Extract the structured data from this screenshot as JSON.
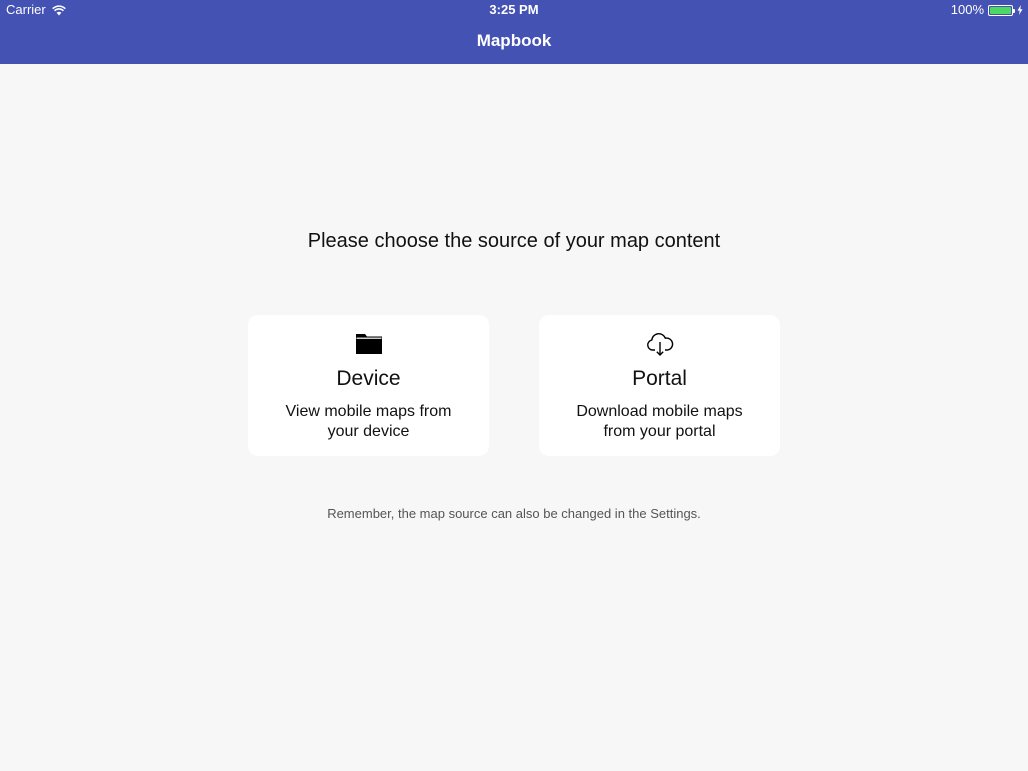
{
  "status_bar": {
    "carrier": "Carrier",
    "time": "3:25 PM",
    "battery": "100%",
    "battery_level": 1.0
  },
  "nav": {
    "title": "Mapbook"
  },
  "main": {
    "prompt": "Please choose the source of your map content",
    "options": [
      {
        "icon": "folder-icon",
        "title": "Device",
        "description": "View mobile maps from your device"
      },
      {
        "icon": "cloud-download-icon",
        "title": "Portal",
        "description": "Download mobile maps from your portal"
      }
    ],
    "reminder": "Remember, the map source can also be changed in the Settings."
  },
  "colors": {
    "nav_background": "#4352b3",
    "page_background": "#f7f7f7",
    "battery_fill": "#4cd964"
  }
}
